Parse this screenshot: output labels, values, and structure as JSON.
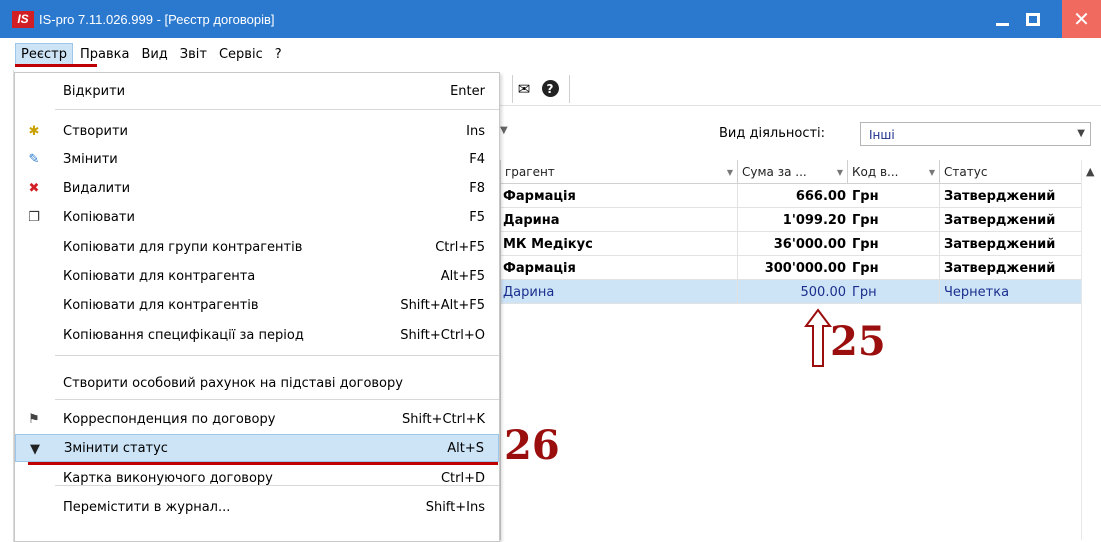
{
  "window": {
    "logo_text": "IS",
    "title": "IS-pro 7.11.026.999 - [Реєстр договорів]",
    "close_symbol": "✕"
  },
  "menubar": {
    "items": [
      {
        "label": "Реєстр",
        "active": true
      },
      {
        "label": "Правка"
      },
      {
        "label": "Вид"
      },
      {
        "label": "Звіт"
      },
      {
        "label": "Сервіс"
      },
      {
        "label": "?"
      }
    ]
  },
  "toolbar": {
    "icons": [
      "mail-icon",
      "help-icon"
    ],
    "help_glyph": "?",
    "mail_glyph": "✉"
  },
  "filter": {
    "vid_label": "Вид діяльності:",
    "vid_value": "Інші"
  },
  "grid": {
    "columns": [
      {
        "label": "грагент"
      },
      {
        "label": "Сума за ..."
      },
      {
        "label": "Код в..."
      },
      {
        "label": "Статус"
      }
    ],
    "rows": [
      {
        "contragent": "Фармація",
        "sum": "666.00",
        "currency": "Грн",
        "status": "Затверджений",
        "bold": true,
        "selected": false
      },
      {
        "contragent": "Дарина",
        "sum": "1'099.20",
        "currency": "Грн",
        "status": "Затверджений",
        "bold": true,
        "selected": false
      },
      {
        "contragent": "МК Медікус",
        "sum": "36'000.00",
        "currency": "Грн",
        "status": "Затверджений",
        "bold": true,
        "selected": false
      },
      {
        "contragent": "Фармація",
        "sum": "300'000.00",
        "currency": "Грн",
        "status": "Затверджений",
        "bold": true,
        "selected": false
      },
      {
        "contragent": "Дарина",
        "sum": "500.00",
        "currency": "Грн",
        "status": "Чернетка",
        "bold": false,
        "selected": true
      }
    ]
  },
  "menu": {
    "items": [
      {
        "label": "Відкрити",
        "shortcut": "Enter",
        "icon": ""
      },
      {
        "label": "Створити",
        "shortcut": "Ins",
        "icon": "create-icon"
      },
      {
        "label": "Змінити",
        "shortcut": "F4",
        "icon": "edit-icon"
      },
      {
        "label": "Видалити",
        "shortcut": "F8",
        "icon": "delete-icon"
      },
      {
        "label": "Копіювати",
        "shortcut": "F5",
        "icon": "copy-icon"
      },
      {
        "label": "Копіювати для групи контрагентів",
        "shortcut": "Ctrl+F5",
        "icon": ""
      },
      {
        "label": "Копіювати для контрагента",
        "shortcut": "Alt+F5",
        "icon": ""
      },
      {
        "label": "Копіювати для контрагентів",
        "shortcut": "Shift+Alt+F5",
        "icon": ""
      },
      {
        "label": "Копіювання специфікації за період",
        "shortcut": "Shift+Ctrl+O",
        "icon": ""
      },
      {
        "label": "Створити особовий рахунок на підставі договору",
        "shortcut": "",
        "icon": ""
      },
      {
        "label": "Корреспонденция по договору",
        "shortcut": "Shift+Ctrl+K",
        "icon": "correspondence-icon"
      },
      {
        "label": "Змінити статус",
        "shortcut": "Alt+S",
        "icon": "change-status-icon",
        "highlighted": true
      },
      {
        "label": "Картка виконуючого договору",
        "shortcut": "Ctrl+D",
        "icon": ""
      },
      {
        "label": "Перемістити в журнал...",
        "shortcut": "Shift+Ins",
        "icon": ""
      }
    ]
  },
  "annotations": {
    "step_25": "25",
    "step_26": "26"
  },
  "colors": {
    "titlebar": "#2b79cf",
    "highlight": "#cde4f7",
    "annotation_red": "#9b0e0e"
  }
}
